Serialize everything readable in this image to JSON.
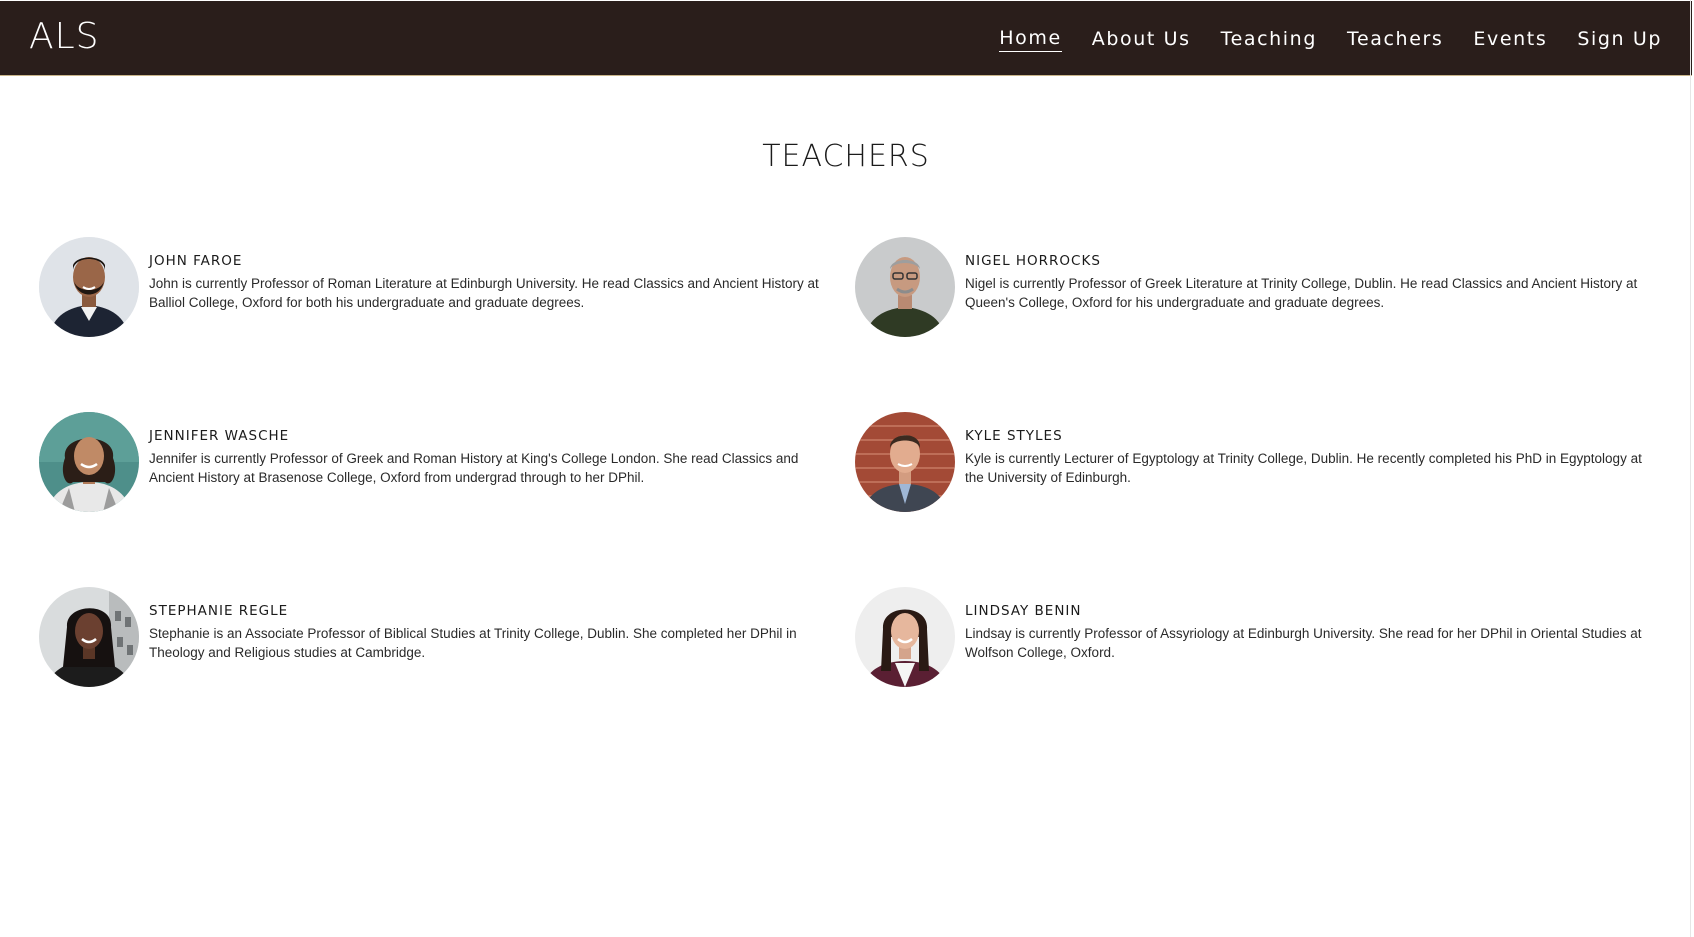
{
  "brand": "ALS",
  "nav": {
    "items": [
      {
        "label": "Home",
        "active": true
      },
      {
        "label": "About Us",
        "active": false
      },
      {
        "label": "Teaching",
        "active": false
      },
      {
        "label": "Teachers",
        "active": false
      },
      {
        "label": "Events",
        "active": false
      },
      {
        "label": "Sign Up",
        "active": false
      }
    ]
  },
  "section": {
    "title": "TEACHERS"
  },
  "teachers": [
    {
      "name": "JOHN FAROE",
      "bio": "John is currently Professor of Roman Literature at Edinburgh University. He read Classics and Ancient History at Balliol College, Oxford for both his undergraduate and graduate degrees."
    },
    {
      "name": "NIGEL HORROCKS",
      "bio": "Nigel is currently Professor of Greek Literature at Trinity College, Dublin. He read Classics and Ancient History at Queen's College, Oxford for his undergraduate and graduate degrees."
    },
    {
      "name": "JENNIFER WASCHE",
      "bio": "Jennifer is currently Professor of Greek and Roman History at King's College London. She read Classics and Ancient History at Brasenose College, Oxford from undergrad through to her DPhil."
    },
    {
      "name": "KYLE STYLES",
      "bio": "Kyle is currently Lecturer of Egyptology at Trinity College, Dublin. He recently completed his PhD in Egyptology at the University of Edinburgh."
    },
    {
      "name": "STEPHANIE REGLE",
      "bio": "Stephanie is an Associate Professor of Biblical Studies at Trinity College, Dublin. She completed her DPhil in Theology and Religious studies at Cambridge."
    },
    {
      "name": "LINDSAY BENIN",
      "bio": "Lindsay is currently Professor of Assyriology at Edinburgh University. She read for her DPhil in Oriental Studies at Wolfson College, Oxford."
    }
  ],
  "colors": {
    "header_bg": "#2a1e1b",
    "header_text": "#ffffff",
    "accent_line": "#c9b58a",
    "body_text": "#1b1b1b"
  }
}
